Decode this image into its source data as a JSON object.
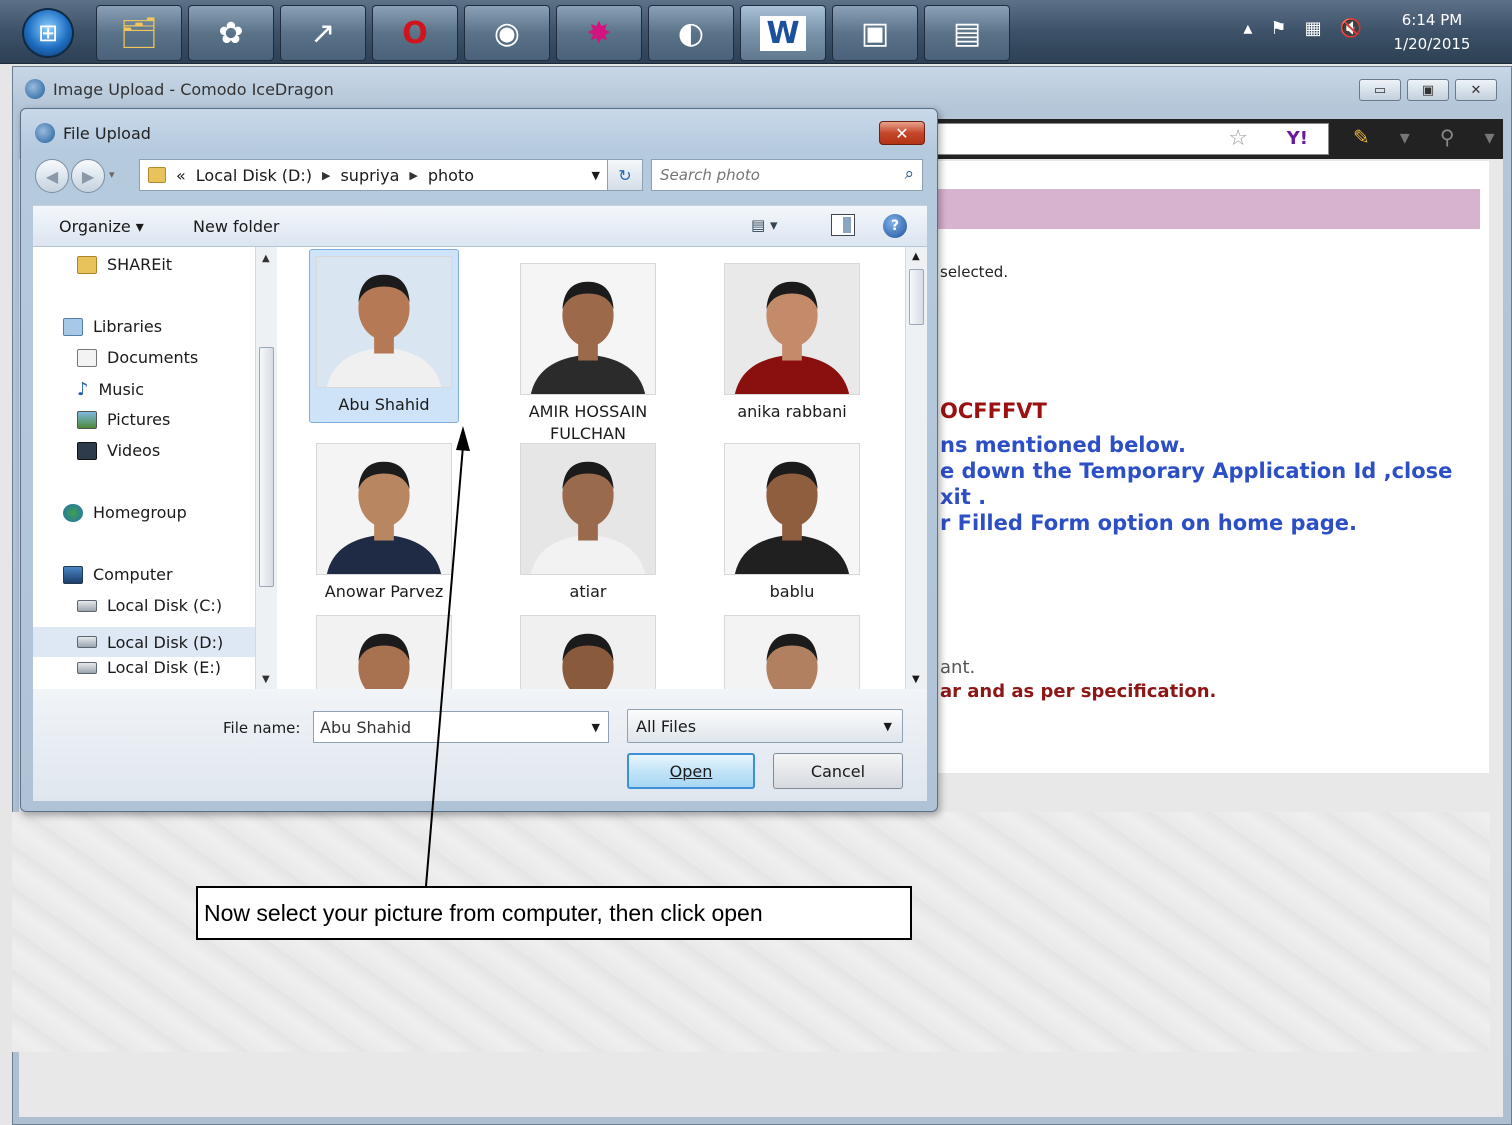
{
  "taskbar": {
    "apps": [
      {
        "name": "explorer",
        "glyph": "🗂"
      },
      {
        "name": "picasa",
        "glyph": "✿"
      },
      {
        "name": "shortcut",
        "glyph": "↗"
      },
      {
        "name": "opera",
        "glyph": "O"
      },
      {
        "name": "media-player",
        "glyph": "◉"
      },
      {
        "name": "app-red",
        "glyph": "✸"
      },
      {
        "name": "icedragon",
        "glyph": "◐"
      },
      {
        "name": "word",
        "glyph": "W"
      },
      {
        "name": "picture-viewer",
        "glyph": "▣"
      },
      {
        "name": "notepad",
        "glyph": "▤"
      }
    ],
    "clock_time": "6:14 PM",
    "clock_date": "1/20/2015"
  },
  "browser": {
    "title": "Image Upload - Comodo IceDragon",
    "page_text": {
      "selected": "selected.",
      "code": "OCFFFVT",
      "line1": "ns mentioned below.",
      "line2": "e down the Temporary Application Id ,close",
      "line3": "xit .",
      "line4": "r Filled Form option on home page.",
      "line5": "ant.",
      "line6": "ar and as per specification."
    }
  },
  "dialog": {
    "title": "File Upload",
    "breadcrumb": [
      "Local Disk (D:)",
      "supriya",
      "photo"
    ],
    "breadcrumb_prefix": "«",
    "search_placeholder": "Search photo",
    "organize_label": "Organize ▾",
    "new_folder_label": "New folder",
    "nav_items": [
      {
        "label": "SHAREit",
        "icon": "folder"
      },
      {
        "label": "Libraries",
        "icon": "lib"
      },
      {
        "label": "Documents",
        "icon": "doc"
      },
      {
        "label": "Music",
        "icon": "music"
      },
      {
        "label": "Pictures",
        "icon": "pic"
      },
      {
        "label": "Videos",
        "icon": "vid"
      },
      {
        "label": "Homegroup",
        "icon": "home"
      },
      {
        "label": "Computer",
        "icon": "comp"
      },
      {
        "label": "Local Disk (C:)",
        "icon": "disk"
      },
      {
        "label": "Local Disk (D:)",
        "icon": "disk",
        "selected": true
      },
      {
        "label": "Local Disk (E:)",
        "icon": "disk"
      }
    ],
    "files": [
      {
        "name": "Abu Shahid",
        "selected": true,
        "bg": "#d9e6f2",
        "shirt": "#f0f0f0",
        "skin": "#b57a55"
      },
      {
        "name": "AMIR HOSSAIN FULCHAN",
        "bg": "#f5f5f5",
        "shirt": "#2b2b2b",
        "skin": "#9c6a4b"
      },
      {
        "name": "anika rabbani",
        "bg": "#e9e9e9",
        "shirt": "#8a1010",
        "skin": "#c48b6a"
      },
      {
        "name": "Anowar Parvez",
        "bg": "#f4f4f4",
        "shirt": "#1f2a44",
        "skin": "#b88660"
      },
      {
        "name": "atiar",
        "bg": "#e6e6e6",
        "shirt": "#f2f2f2",
        "skin": "#9a6a4c"
      },
      {
        "name": "bablu",
        "bg": "#f6f6f6",
        "shirt": "#202020",
        "skin": "#8f5e3f"
      },
      {
        "name": "",
        "bg": "#f2f2f2",
        "shirt": "#444",
        "skin": "#a87250"
      },
      {
        "name": "",
        "bg": "#f0f0f0",
        "shirt": "#333",
        "skin": "#8a5a3c"
      },
      {
        "name": "",
        "bg": "#f3f3f3",
        "shirt": "#555",
        "skin": "#b08060"
      }
    ],
    "file_name_label": "File name:",
    "file_name_value": "Abu Shahid",
    "file_type_value": "All Files",
    "open_label": "Open",
    "cancel_label": "Cancel"
  },
  "annotation": {
    "text": "Now select your picture from computer, then click open"
  }
}
